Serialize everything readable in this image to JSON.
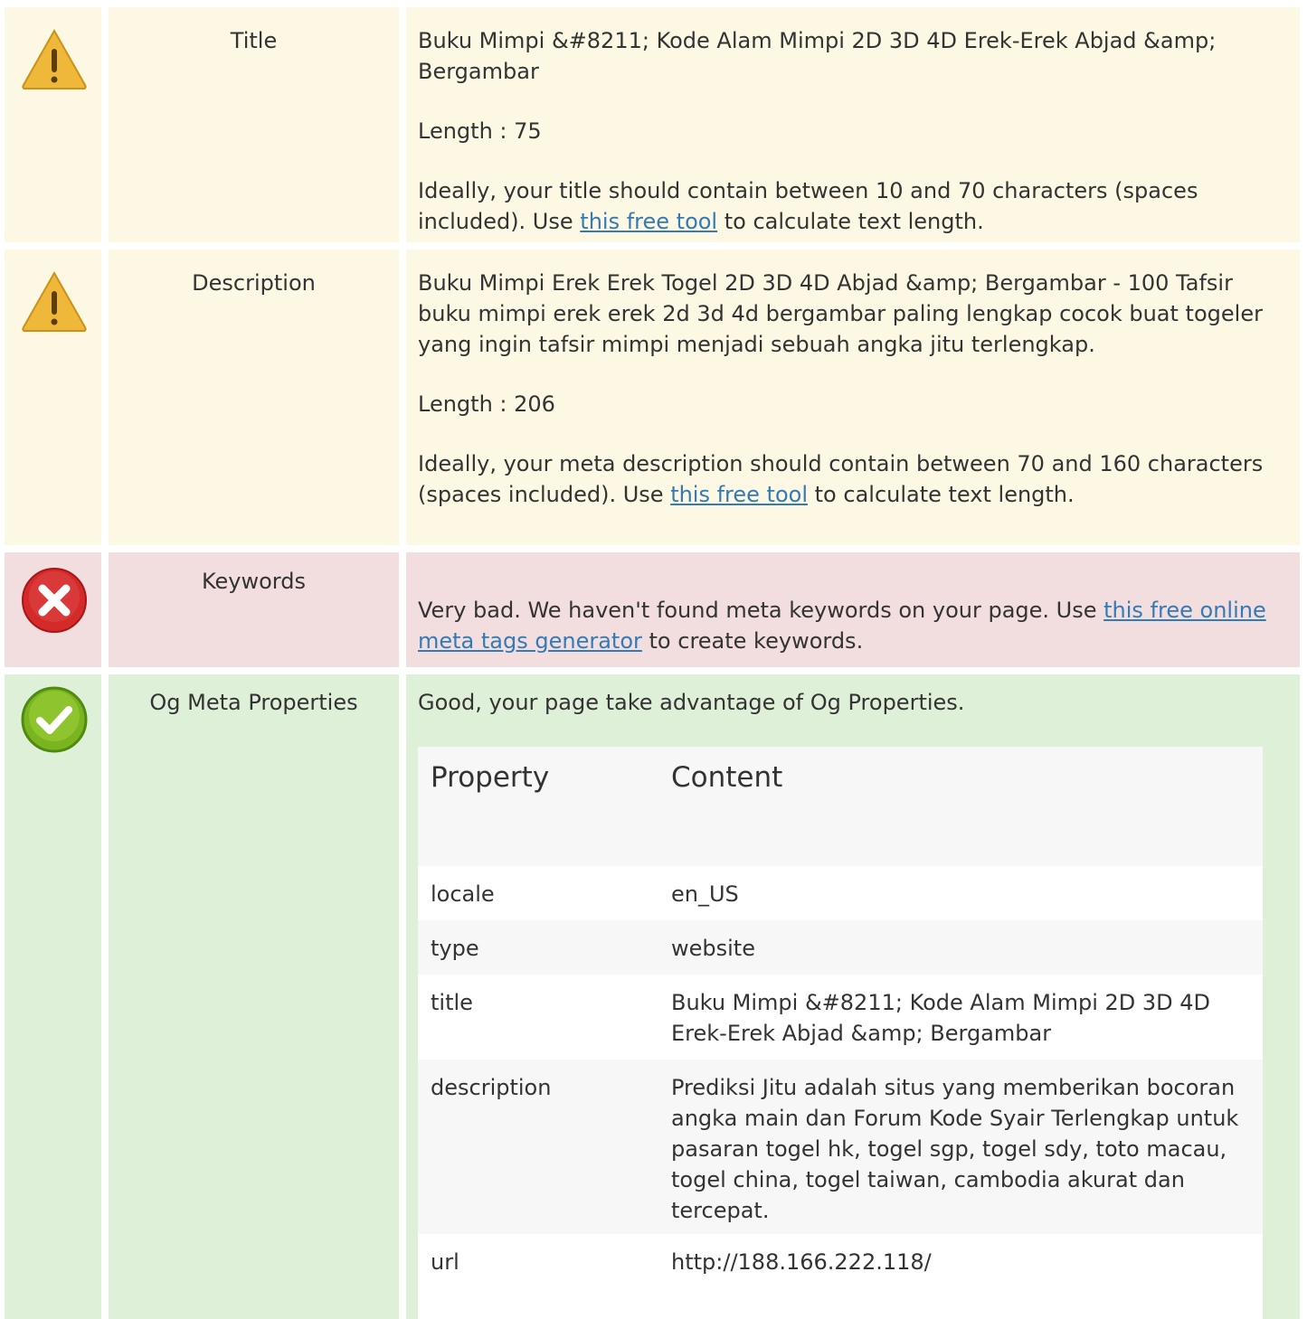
{
  "colors": {
    "warning_bg": "#fcf8e3",
    "error_bg": "#f2dede",
    "success_bg": "#dff0d8",
    "link": "#337ab7",
    "warning_icon": "#f0b83a",
    "error_icon": "#d42a2a",
    "success_icon": "#7ab51f"
  },
  "rows": {
    "title": {
      "status": "warning",
      "icon": "warning-icon",
      "label": "Title",
      "value": "Buku Mimpi &#8211; Kode Alam Mimpi 2D 3D 4D Erek-Erek Abjad &amp; Bergambar",
      "length": "Length : 75",
      "advice_before": "Ideally, your title should contain between 10 and 70 characters (spaces included). Use ",
      "advice_link": "this free tool",
      "advice_after": " to calculate text length."
    },
    "description": {
      "status": "warning",
      "icon": "warning-icon",
      "label": "Description",
      "value": "Buku Mimpi Erek Erek Togel 2D 3D 4D Abjad &amp; Bergambar - 100 Tafsir buku mimpi erek erek 2d 3d 4d bergambar paling lengkap cocok buat togeler yang ingin tafsir mimpi menjadi sebuah angka jitu terlengkap.",
      "length": "Length : 206",
      "advice_before": "Ideally, your meta description should contain between 70 and 160 characters (spaces included). Use ",
      "advice_link": "this free tool",
      "advice_after": " to calculate text length."
    },
    "keywords": {
      "status": "error",
      "icon": "error-icon",
      "label": "Keywords",
      "message_before": "Very bad. We haven't found meta keywords on your page. Use ",
      "message_link": "this free online meta tags generator",
      "message_after": " to create keywords."
    },
    "og": {
      "status": "success",
      "icon": "check-icon",
      "label": "Og Meta Properties",
      "message": "Good, your page take advantage of Og Properties.",
      "table": {
        "headers": [
          "Property",
          "Content"
        ],
        "rows": [
          {
            "property": "locale",
            "content": "en_US"
          },
          {
            "property": "type",
            "content": "website"
          },
          {
            "property": "title",
            "content": "Buku Mimpi &#8211; Kode Alam Mimpi 2D 3D 4D Erek-Erek Abjad &amp; Bergambar"
          },
          {
            "property": "description",
            "content": "Prediksi Jitu adalah situs yang memberikan bocoran angka main dan Forum Kode Syair Terlengkap untuk pasaran togel hk, togel sgp, togel sdy, toto macau, togel china, togel taiwan, cambodia akurat dan tercepat."
          },
          {
            "property": "url",
            "content": "http://188.166.222.118/"
          }
        ]
      }
    }
  }
}
